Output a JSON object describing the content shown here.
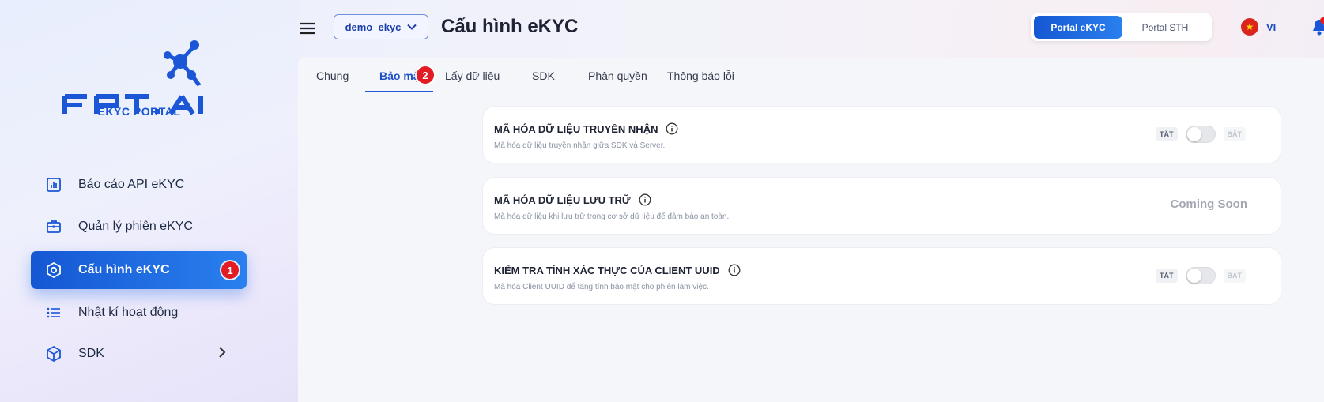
{
  "sidebar": {
    "logo_text": "FPT.AI",
    "logo_sub": "EKYC PORTAL",
    "items": [
      {
        "label": "Báo cáo API eKYC",
        "icon": "chart-report-icon"
      },
      {
        "label": "Quản lý phiên eKYC",
        "icon": "briefcase-icon"
      },
      {
        "label": "Cấu hình eKYC",
        "icon": "settings-hexagon-icon",
        "active": true,
        "badge": "1"
      },
      {
        "label": "Nhật kí hoạt động",
        "icon": "list-icon"
      },
      {
        "label": "SDK",
        "icon": "cube-icon",
        "has_submenu": true
      }
    ]
  },
  "header": {
    "project_select": "demo_ekyc",
    "title": "Cấu hình eKYC",
    "portal_tabs": [
      {
        "label": "Portal eKYC",
        "active": true
      },
      {
        "label": "Portal STH",
        "active": false
      }
    ],
    "language": "VI"
  },
  "tabs": [
    {
      "label": "Chung"
    },
    {
      "label": "Bảo mật",
      "active": true,
      "badge": "2"
    },
    {
      "label": "Lấy dữ liệu"
    },
    {
      "label": "SDK"
    },
    {
      "label": "Phân quyền"
    },
    {
      "label": "Thông báo lỗi"
    }
  ],
  "settings": [
    {
      "title": "MÃ HÓA DỮ LIỆU TRUYỀN NHẬN",
      "description": "Mã hóa dữ liệu truyền nhận giữa SDK và Server.",
      "control": "toggle",
      "off_label": "TẮT",
      "on_label": "BẬT",
      "enabled": false
    },
    {
      "title": "MÃ HÓA DỮ LIỆU LƯU TRỮ",
      "description": "Mã hóa dữ liệu khi lưu trữ trong cơ sở dữ liệu để đảm bảo an toàn.",
      "control": "status",
      "status": "Coming Soon"
    },
    {
      "title": "KIỂM TRA TÍNH XÁC THỰC CỦA CLIENT UUID",
      "description": "Mã hóa Client UUID để tăng tính bảo mật cho phiên làm việc.",
      "control": "toggle",
      "off_label": "TẮT",
      "on_label": "BẬT",
      "enabled": false
    }
  ],
  "colors": {
    "accent": "#1d5ad6",
    "badge": "#e31b23",
    "active_gradient_start": "#1557d3",
    "active_gradient_end": "#2a80ee"
  }
}
